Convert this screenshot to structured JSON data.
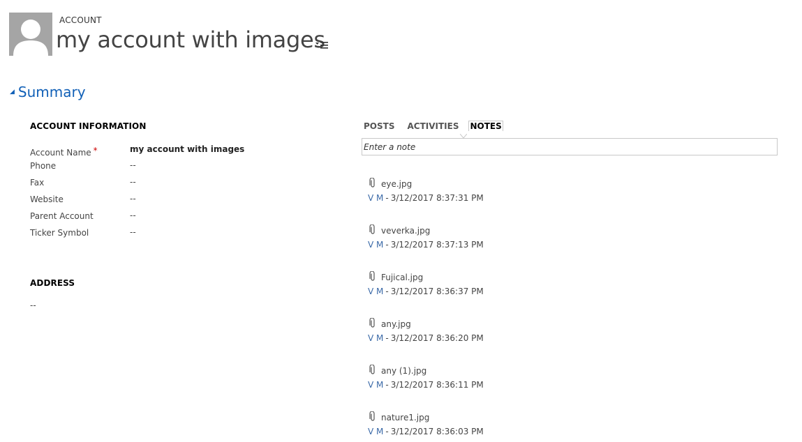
{
  "header": {
    "entity_type": "ACCOUNT",
    "title": "my account with images",
    "menu_icon": "list-menu-icon",
    "avatar_icon": "person-silhouette-icon"
  },
  "section": {
    "title": "Summary"
  },
  "account_info": {
    "title": "ACCOUNT INFORMATION",
    "fields": [
      {
        "label": "Account Name",
        "value": "my account with images",
        "required": "*"
      },
      {
        "label": "Phone",
        "value": "--"
      },
      {
        "label": "Fax",
        "value": "--"
      },
      {
        "label": "Website",
        "value": "--"
      },
      {
        "label": "Parent Account",
        "value": "--"
      },
      {
        "label": "Ticker Symbol",
        "value": "--"
      }
    ]
  },
  "address": {
    "title": "ADDRESS",
    "value": "--"
  },
  "social": {
    "tabs": [
      "POSTS",
      "ACTIVITIES",
      "NOTES"
    ],
    "active_tab": "NOTES",
    "note_placeholder": "Enter a note",
    "notes": [
      {
        "file": "eye.jpg",
        "author": "V M",
        "separator": "-",
        "date": "3/12/2017 8:37:31 PM"
      },
      {
        "file": "veverka.jpg",
        "author": "V M",
        "separator": "-",
        "date": "3/12/2017 8:37:13 PM"
      },
      {
        "file": "Fujical.jpg",
        "author": "V M",
        "separator": "-",
        "date": "3/12/2017 8:36:37 PM"
      },
      {
        "file": "any.jpg",
        "author": "V M",
        "separator": "-",
        "date": "3/12/2017 8:36:20 PM"
      },
      {
        "file": "any (1).jpg",
        "author": "V M",
        "separator": "-",
        "date": "3/12/2017 8:36:11 PM"
      },
      {
        "file": "nature1.jpg",
        "author": "V M",
        "separator": "-",
        "date": "3/12/2017 8:36:03 PM"
      }
    ]
  },
  "colors": {
    "accent": "#1160b7",
    "link": "#3b6aa8",
    "required": "#cc0000",
    "avatar_bg": "#a5a5a5"
  }
}
